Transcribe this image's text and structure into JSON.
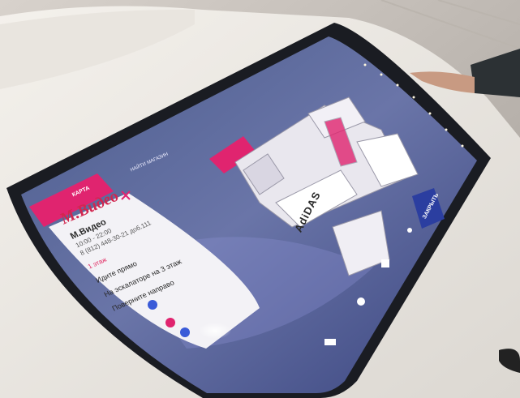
{
  "map": {
    "store_label": "AdiDAS"
  },
  "panel": {
    "brand": "М.Видео",
    "name": "М.Видео",
    "hours": "10:00 - 22:00",
    "phone": "8 (812) 448-30-21 доб.111",
    "floor": "1 этаж",
    "steps": [
      "Идите прямо",
      "На эскалаторе на 3 этаж",
      "Поверните направо"
    ]
  },
  "menu": {
    "label": "КАРТА"
  },
  "search": {
    "label": "НАЙТИ МАГАЗИН"
  },
  "button": {
    "label": "ЗАКРЫТЬ"
  },
  "colors": {
    "accent": "#e0246f",
    "button": "#2b3ea0",
    "screen_bezel": "#1a1c22"
  }
}
